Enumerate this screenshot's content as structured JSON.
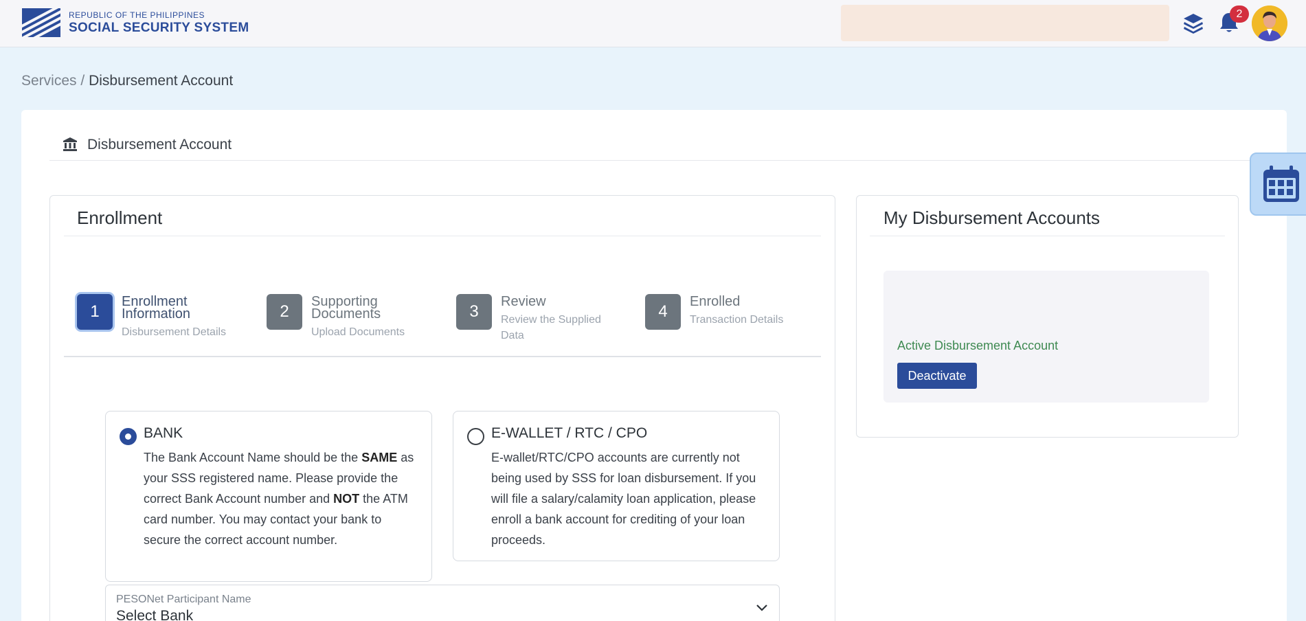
{
  "header": {
    "logo_sub": "REPUBLIC OF THE PHILIPPINES",
    "logo_main": "SOCIAL SECURITY SYSTEM",
    "notification_count": "2",
    "icons": [
      "layers-icon",
      "bell-icon",
      "avatar"
    ]
  },
  "breadcrumb": {
    "parent": "Services",
    "separator": "/",
    "current": "Disbursement Account"
  },
  "page": {
    "title": "Disbursement Account"
  },
  "enrollment": {
    "title": "Enrollment",
    "steps": [
      {
        "num": "1",
        "label": "Enrollment Information",
        "sub": "Disbursement Details",
        "active": true
      },
      {
        "num": "2",
        "label": "Supporting Documents",
        "sub": "Upload Documents",
        "active": false
      },
      {
        "num": "3",
        "label": "Review",
        "sub": "Review the Supplied Data",
        "active": false
      },
      {
        "num": "4",
        "label": "Enrolled",
        "sub": "Transaction Details",
        "active": false
      }
    ],
    "options": {
      "bank": {
        "title": "BANK",
        "selected": true,
        "body_parts": {
          "p1": "The Bank Account Name should be the ",
          "b1": "SAME",
          "p2": " as your SSS registered name. Please provide the correct Bank Account number and ",
          "b2": "NOT",
          "p3": " the ATM card number. You may contact your bank to secure the correct account number."
        }
      },
      "ewallet": {
        "title": "E-WALLET / RTC / CPO",
        "selected": false,
        "body": "E-wallet/RTC/CPO accounts are currently not being used by SSS for loan disbursement. If you will file a salary/calamity loan application, please enroll a bank account for crediting of your loan proceeds."
      }
    },
    "select": {
      "label": "PESONet Participant Name",
      "value": "Select Bank"
    }
  },
  "accounts": {
    "title": "My Disbursement Accounts",
    "status": "Active Disbursement Account",
    "deactivate_label": "Deactivate"
  },
  "colors": {
    "brand": "#2b4c9a",
    "page_bg": "#e8f3fb",
    "active_status": "#3f8a52",
    "badge": "#d32f3f"
  }
}
